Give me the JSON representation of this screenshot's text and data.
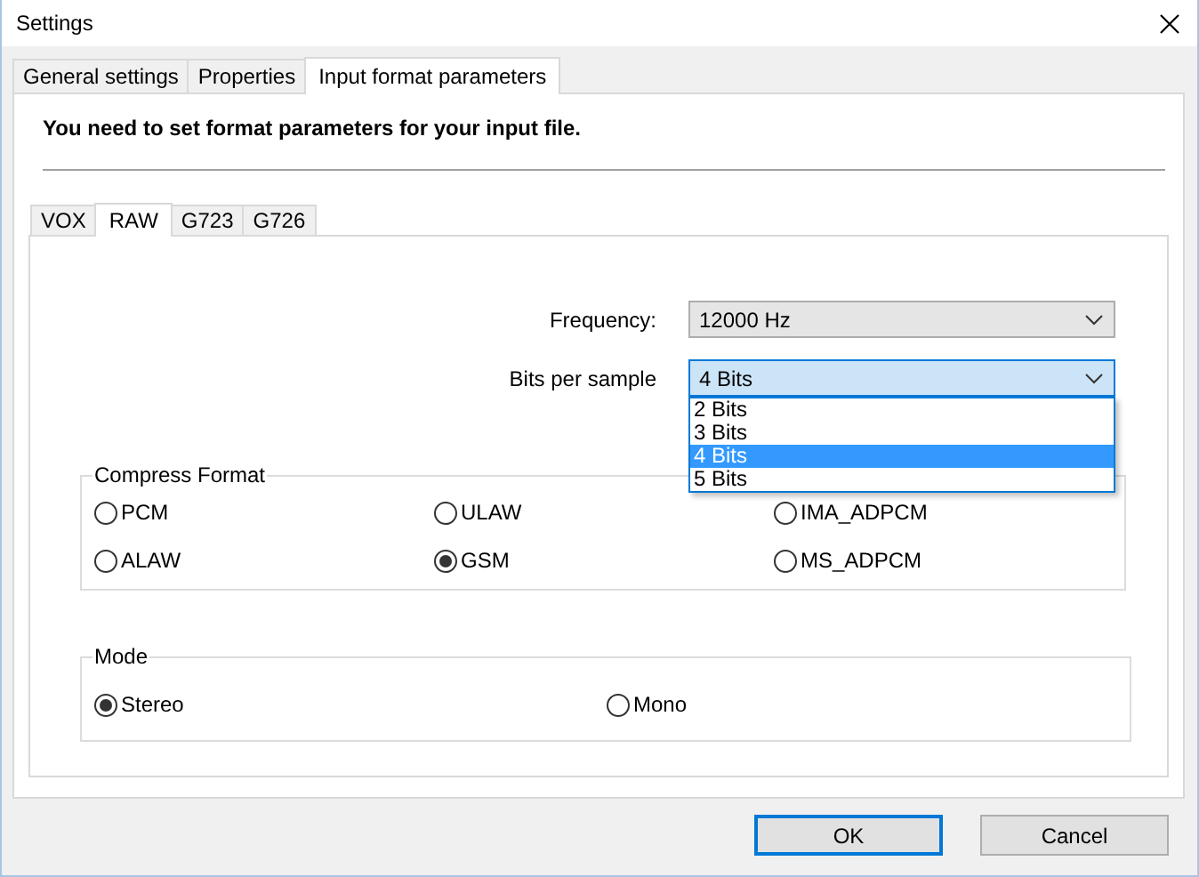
{
  "window": {
    "title": "Settings"
  },
  "tabs": [
    {
      "label": "General settings",
      "selected": false
    },
    {
      "label": "Properties",
      "selected": false
    },
    {
      "label": "Input format parameters",
      "selected": true
    }
  ],
  "header": "You need to set format parameters for your input file.",
  "format_tabs": [
    {
      "label": "VOX",
      "selected": false
    },
    {
      "label": "RAW",
      "selected": true
    },
    {
      "label": "G723",
      "selected": false
    },
    {
      "label": "G726",
      "selected": false
    }
  ],
  "frequency": {
    "label": "Frequency:",
    "value": "12000 Hz",
    "expanded": false
  },
  "bits_per_sample": {
    "label": "Bits per sample",
    "value": "4 Bits",
    "expanded": true,
    "options": [
      {
        "label": "2 Bits",
        "selected": false
      },
      {
        "label": "3 Bits",
        "selected": false
      },
      {
        "label": "4 Bits",
        "selected": true
      },
      {
        "label": "5 Bits",
        "selected": false
      }
    ]
  },
  "compress_format": {
    "title": "Compress Format",
    "options": [
      {
        "label": "PCM",
        "selected": false
      },
      {
        "label": "ULAW",
        "selected": false
      },
      {
        "label": "IMA_ADPCM",
        "selected": false
      },
      {
        "label": "ALAW",
        "selected": false
      },
      {
        "label": "GSM",
        "selected": true
      },
      {
        "label": "MS_ADPCM",
        "selected": false
      }
    ]
  },
  "mode": {
    "title": "Mode",
    "options": [
      {
        "label": "Stereo",
        "selected": true
      },
      {
        "label": "Mono",
        "selected": false
      }
    ]
  },
  "buttons": [
    {
      "label": "OK",
      "kind": "default"
    },
    {
      "label": "Cancel",
      "kind": "normal"
    }
  ]
}
